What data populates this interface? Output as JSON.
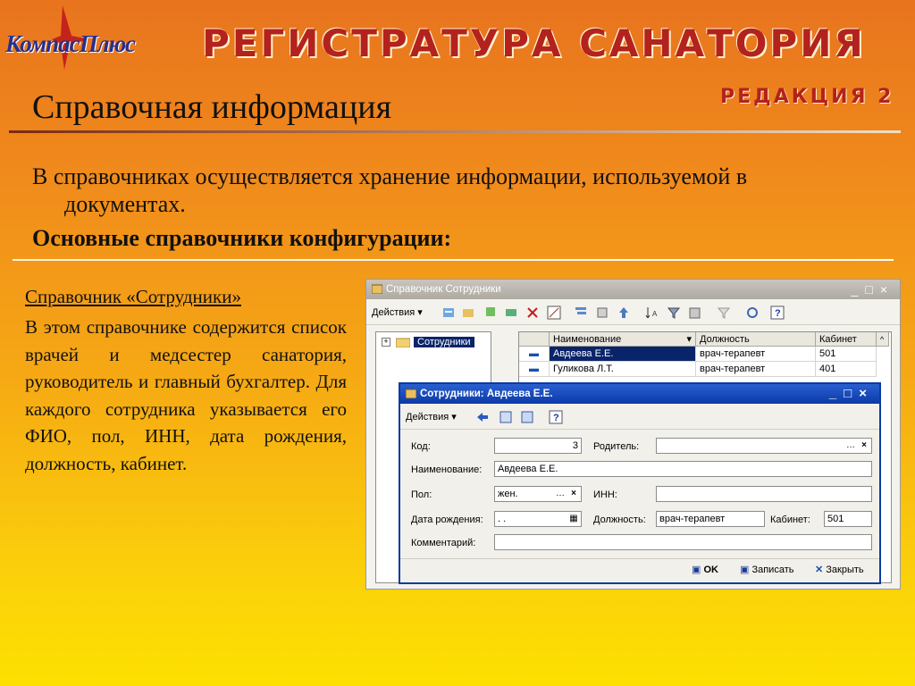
{
  "header": {
    "logo_text": "КомпасПлюс",
    "app_title": "РЕГИСТРАТУРА САНАТОРИЯ",
    "edition": "РЕДАКЦИЯ 2"
  },
  "slide": {
    "title": "Справочная информация",
    "intro_line1": "В справочниках осуществляется хранение информации, используемой в",
    "intro_line2": "документах.",
    "subheading": "Основные справочники конфигурации:",
    "side_heading": "Справочник «Сотрудники»",
    "side_text": "В этом справочнике содержится список врачей и медсестер санатория, руководитель и главный бухгалтер. Для каждого сотрудника указывается его ФИО, пол, ИНН, дата рождения, должность, кабинет."
  },
  "list_window": {
    "title": "Справочник Сотрудники",
    "actions_label": "Действия",
    "tree_root": "Сотрудники",
    "columns": [
      "Наименование",
      "Должность",
      "Кабинет"
    ],
    "rows": [
      {
        "name": "Авдеева Е.Е.",
        "position": "врач-терапевт",
        "room": "501"
      },
      {
        "name": "Гуликова Л.Т.",
        "position": "врач-терапевт",
        "room": "401"
      }
    ]
  },
  "dialog": {
    "title": "Сотрудники: Авдеева Е.Е.",
    "actions_label": "Действия",
    "code_label": "Код:",
    "code_value": "3",
    "parent_label": "Родитель:",
    "name_label": "Наименование:",
    "name_value": "Авдеева Е.Е.",
    "gender_label": "Пол:",
    "gender_value": "жен.",
    "inn_label": "ИНН:",
    "birth_label": "Дата рождения:",
    "birth_value": " .  .",
    "position_label": "Должность:",
    "position_value": "врач-терапевт",
    "room_label": "Кабинет:",
    "room_value": "501",
    "comment_label": "Комментарий:",
    "ok_label": "OK",
    "save_label": "Записать",
    "close_label": "Закрыть"
  },
  "colors": {
    "title_red": "#b3221d",
    "selection": "#0a246a",
    "dialog_title": "#0b3aa8"
  }
}
